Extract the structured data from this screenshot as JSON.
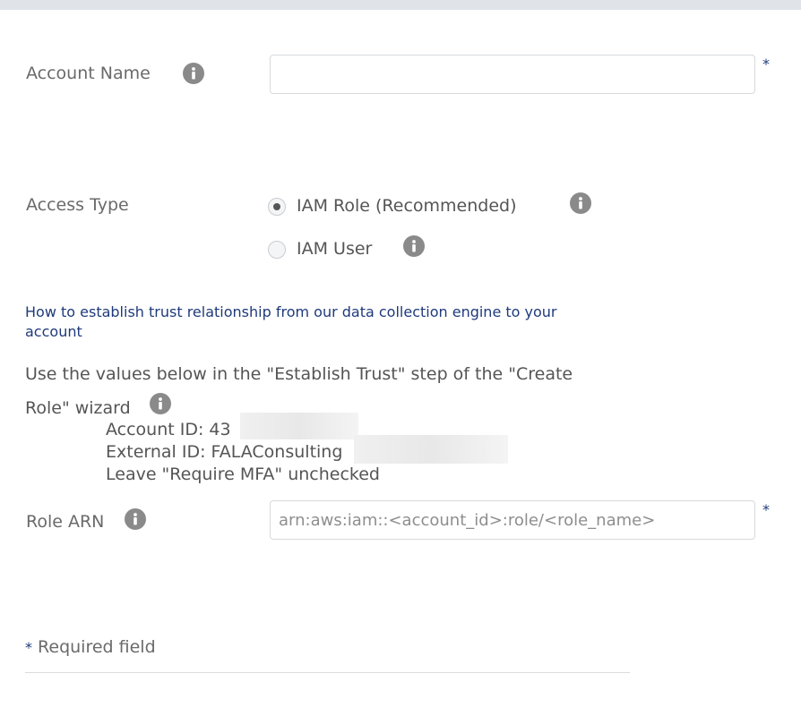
{
  "form": {
    "account_name": {
      "label": "Account Name",
      "value": "",
      "placeholder": "",
      "required_marker": "*",
      "info_icon": "info-icon"
    },
    "access_type": {
      "label": "Access Type",
      "options": [
        {
          "label": "IAM Role (Recommended)",
          "selected": true
        },
        {
          "label": "IAM User",
          "selected": false
        }
      ]
    },
    "trust": {
      "link_text": "How to establish trust relationship from our data collection engine to your account",
      "instructions": "Use the values below in the \"Establish Trust\" step of the \"Create Role\" wizard",
      "account_id": "Account ID: 43",
      "external_id": "External ID: FALAConsulting",
      "mfa_note": "Leave \"Require MFA\" unchecked"
    },
    "role_arn": {
      "label": "Role ARN",
      "value": "",
      "placeholder": "arn:aws:iam::<account_id>:role/<role_name>",
      "required_marker": "*"
    },
    "footer": {
      "required_note_star": "*",
      "required_note": "Required field"
    }
  },
  "colors": {
    "link": "#1f3a7a",
    "label": "#6a6a6a",
    "info_icon": "#8a8a8a",
    "input_border": "#d6d9dc"
  }
}
